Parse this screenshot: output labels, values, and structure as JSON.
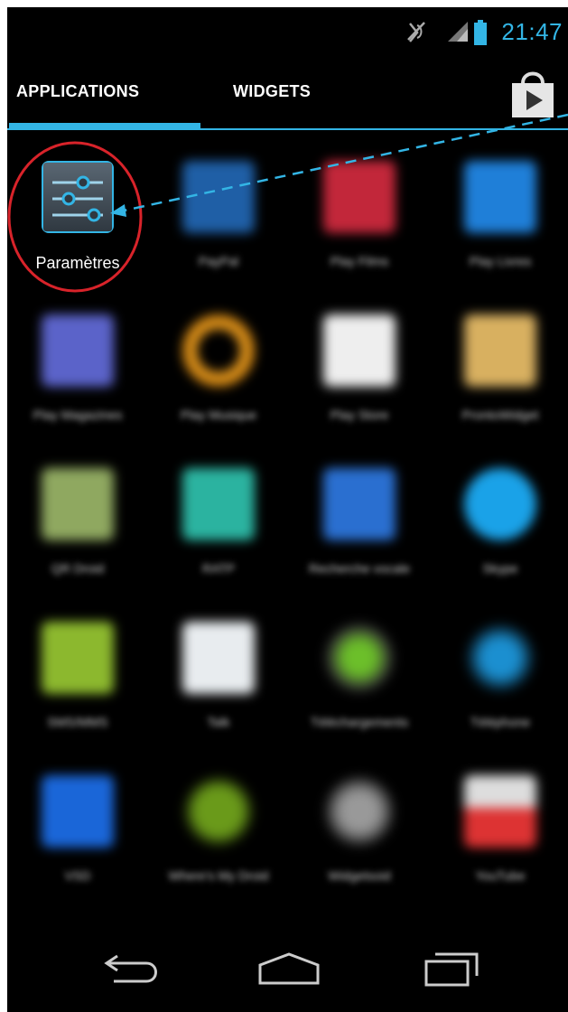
{
  "status_bar": {
    "time": "21:47",
    "icons": [
      "mute-icon",
      "signal-icon",
      "battery-icon"
    ]
  },
  "tabs": [
    {
      "label": "APPLICATIONS",
      "selected": true
    },
    {
      "label": "WIDGETS",
      "selected": false
    }
  ],
  "store_icon": "play-store-bag-icon",
  "apps": [
    {
      "label": "Paramètres",
      "icon": "settings-sliders-icon",
      "blurred": false
    },
    {
      "label": "PayPal",
      "icon": "paypal-icon",
      "blurred": true
    },
    {
      "label": "Play Films",
      "icon": "play-films-icon",
      "blurred": true
    },
    {
      "label": "Play Livres",
      "icon": "play-books-icon",
      "blurred": true
    },
    {
      "label": "Play Magazines",
      "icon": "play-magazines-icon",
      "blurred": true
    },
    {
      "label": "Play Musique",
      "icon": "headphones-icon",
      "blurred": true
    },
    {
      "label": "Play Store",
      "icon": "play-store-icon",
      "blurred": true
    },
    {
      "label": "ProntoWidget",
      "icon": "app-icon",
      "blurred": true
    },
    {
      "label": "QR Droid",
      "icon": "qr-icon",
      "blurred": true
    },
    {
      "label": "RATP",
      "icon": "ratp-icon",
      "blurred": true
    },
    {
      "label": "Recherche vocale",
      "icon": "microphone-icon",
      "blurred": true
    },
    {
      "label": "Skype",
      "icon": "skype-icon",
      "blurred": true
    },
    {
      "label": "SMS/MMS",
      "icon": "sms-icon",
      "blurred": true
    },
    {
      "label": "Talk",
      "icon": "talk-icon",
      "blurred": true
    },
    {
      "label": "Téléchargements",
      "icon": "download-icon",
      "blurred": true
    },
    {
      "label": "Téléphone",
      "icon": "phone-icon",
      "blurred": true
    },
    {
      "label": "VSD",
      "icon": "app-icon",
      "blurred": true
    },
    {
      "label": "Where's My Droid",
      "icon": "android-icon",
      "blurred": true
    },
    {
      "label": "Widgetsoid",
      "icon": "widget-icon",
      "blurred": true
    },
    {
      "label": "YouTube",
      "icon": "youtube-icon",
      "blurred": true
    }
  ],
  "annotation": {
    "highlight_color": "#d8232a",
    "arrow_color": "#33b5e5",
    "target": "Paramètres"
  },
  "navigation": [
    "back-icon",
    "home-icon",
    "recent-apps-icon"
  ],
  "colors": {
    "accent": "#33b5e5",
    "background": "#000000"
  }
}
